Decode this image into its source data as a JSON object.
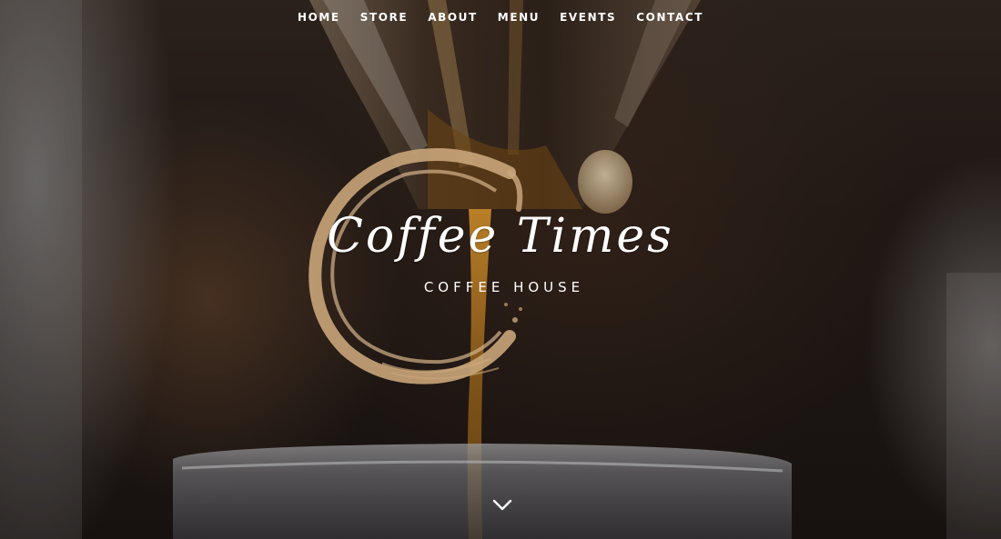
{
  "nav": {
    "items": [
      {
        "label": "HOME"
      },
      {
        "label": "STORE"
      },
      {
        "label": "ABOUT"
      },
      {
        "label": "MENU"
      },
      {
        "label": "EVENTS"
      },
      {
        "label": "CONTACT"
      }
    ]
  },
  "logo": {
    "title": "Coffee Times",
    "subtitle": "COFFEE HOUSE",
    "ring_color": "#c9a57a"
  },
  "scroll": {
    "icon": "chevron-down-icon"
  },
  "colors": {
    "text": "#ffffff",
    "background": "#1e1714",
    "accent": "#c9a57a",
    "coffee_stream": "#8a5a1a"
  }
}
